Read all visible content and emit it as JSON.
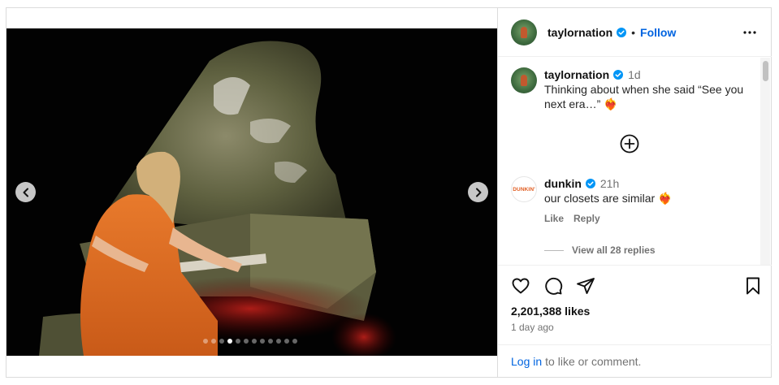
{
  "account": {
    "username": "taylornation",
    "verified": true,
    "separator": "•",
    "follow_label": "Follow"
  },
  "media": {
    "slide_count": 12,
    "active_slide": 4
  },
  "caption": {
    "username": "taylornation",
    "time": "1d",
    "text": "Thinking about when she said “See you next era…” ❤️‍🔥"
  },
  "comments": [
    {
      "username": "dunkin",
      "avatar_text": "DUNKIN'",
      "time": "21h",
      "text": "our closets are similar ❤️‍🔥",
      "like_label": "Like",
      "reply_label": "Reply",
      "view_replies_label": "View all 28 replies"
    }
  ],
  "engagement": {
    "likes": "2,201,388 likes",
    "posted_ago": "1 day ago"
  },
  "login_prompt": {
    "link": "Log in",
    "text": "to like or comment."
  },
  "colors": {
    "link_blue": "#0064e0",
    "verified_blue": "#0095f6",
    "muted": "#737373",
    "border": "#dbdbdb"
  },
  "icons": [
    "chevron-left-icon",
    "chevron-right-icon",
    "more-icon",
    "verified-icon",
    "add-circle-icon",
    "heart-icon",
    "comment-icon",
    "share-icon",
    "bookmark-icon"
  ]
}
